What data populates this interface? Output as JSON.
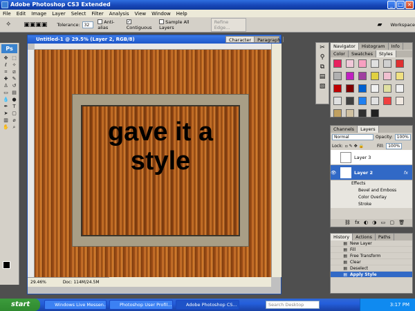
{
  "window": {
    "title": "Adobe Photoshop CS3 Extended"
  },
  "menu": [
    "File",
    "Edit",
    "Image",
    "Layer",
    "Select",
    "Filter",
    "Analysis",
    "View",
    "Window",
    "Help"
  ],
  "options": {
    "tolerance_label": "Tolerance:",
    "tolerance_value": "32",
    "antialias": "Anti-alias",
    "contiguous": "Contiguous",
    "sample_all": "Sample All Layers",
    "refine": "Refine Edge...",
    "workspace": "Workspace"
  },
  "toolbox": {
    "logo": "Ps"
  },
  "document": {
    "title": "Untitled-1 @ 29.5% (Layer 2, RGB/8)",
    "canvas_text_line1": "gave it a",
    "canvas_text_line2": "style",
    "zoom": "29.46%",
    "doc_info": "Doc: 114M/24.5M"
  },
  "panel_tabs_top": [
    "Character",
    "Paragraph"
  ],
  "navigator_tabs": [
    "Navigator",
    "Histogram",
    "Info"
  ],
  "styles_tabs": [
    "Color",
    "Swatches",
    "Styles"
  ],
  "style_colors": [
    "#e8215f",
    "#f0c8d8",
    "#f7a0c0",
    "#e0e0e0",
    "#d0d0d0",
    "#e03030",
    "#b0b0b0",
    "#c020c0",
    "#a040a0",
    "#e0d040",
    "#f0c0d0",
    "#f0e080",
    "#c00000",
    "#800000",
    "#0060d0",
    "#f0f0f0",
    "#e0e0a0",
    "#f0f0f0",
    "#e0e0e0",
    "#404040",
    "#2080f0",
    "#e0e0e0",
    "#f04040",
    "#f0e8e0",
    "#c0a060",
    "#d0c0a0",
    "#303030",
    "#202020"
  ],
  "layers_tabs": [
    "Channels",
    "Layers"
  ],
  "layers": {
    "blend": "Normal",
    "opacity_label": "Opacity:",
    "opacity": "100%",
    "lock_label": "Lock:",
    "fill_label": "Fill:",
    "fill": "100%",
    "items": [
      {
        "name": "Layer 3"
      },
      {
        "name": "Layer 2",
        "fx": "fx"
      }
    ],
    "effects_label": "Effects",
    "effects": [
      "Bevel and Emboss",
      "Color Overlay",
      "Stroke"
    ]
  },
  "history_tabs": [
    "History",
    "Actions",
    "Paths"
  ],
  "history": [
    "New Layer",
    "Fill",
    "Free Transform",
    "Clear",
    "Deselect",
    "Apply Style"
  ],
  "taskbar": {
    "start": "start",
    "tasks": [
      "Windows Live Messen...",
      "Photoshop User Profil...",
      "Adobe Photoshop CS..."
    ],
    "search": "Search Desktop",
    "time": "3:17 PM"
  }
}
